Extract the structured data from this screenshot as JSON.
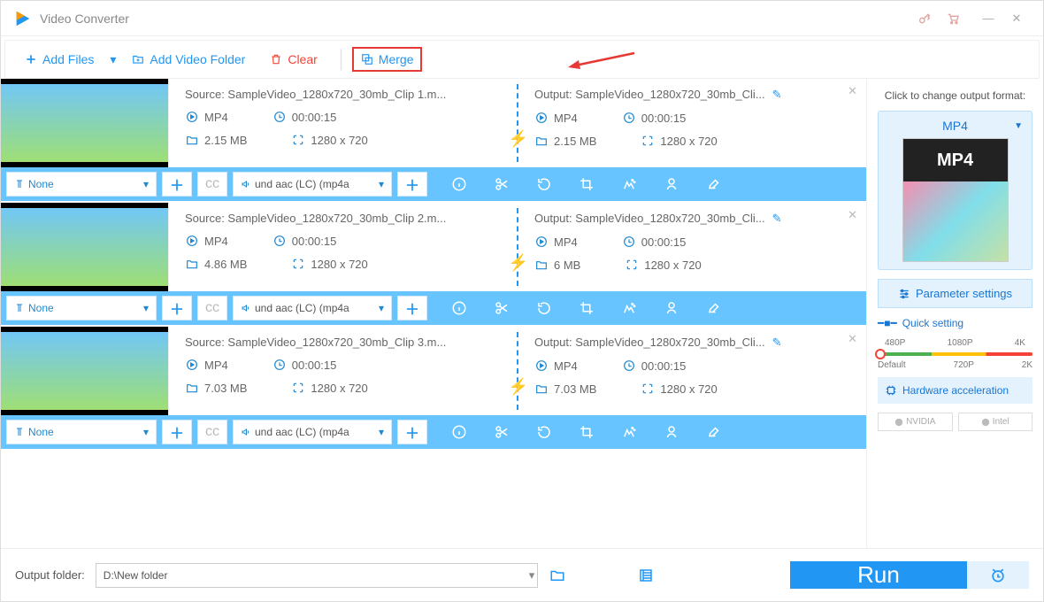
{
  "app": {
    "title": "Video Converter"
  },
  "toolbar": {
    "add_files": "Add Files",
    "add_folder": "Add Video Folder",
    "clear": "Clear",
    "merge": "Merge"
  },
  "clips": [
    {
      "source": "Source: SampleVideo_1280x720_30mb_Clip 1.m...",
      "output": "Output: SampleVideo_1280x720_30mb_Cli...",
      "src_fmt": "MP4",
      "src_dur": "00:00:15",
      "src_size": "2.15 MB",
      "src_res": "1280 x 720",
      "out_fmt": "MP4",
      "out_dur": "00:00:15",
      "out_size": "2.15 MB",
      "out_res": "1280 x 720",
      "subtitle": "None",
      "audio": "und aac (LC) (mp4a"
    },
    {
      "source": "Source: SampleVideo_1280x720_30mb_Clip 2.m...",
      "output": "Output: SampleVideo_1280x720_30mb_Cli...",
      "src_fmt": "MP4",
      "src_dur": "00:00:15",
      "src_size": "4.86 MB",
      "src_res": "1280 x 720",
      "out_fmt": "MP4",
      "out_dur": "00:00:15",
      "out_size": "6 MB",
      "out_res": "1280 x 720",
      "subtitle": "None",
      "audio": "und aac (LC) (mp4a"
    },
    {
      "source": "Source: SampleVideo_1280x720_30mb_Clip 3.m...",
      "output": "Output: SampleVideo_1280x720_30mb_Cli...",
      "src_fmt": "MP4",
      "src_dur": "00:00:15",
      "src_size": "7.03 MB",
      "src_res": "1280 x 720",
      "out_fmt": "MP4",
      "out_dur": "00:00:15",
      "out_size": "7.03 MB",
      "out_res": "1280 x 720",
      "subtitle": "None",
      "audio": "und aac (LC) (mp4a"
    }
  ],
  "bottom": {
    "output_folder_label": "Output folder:",
    "output_folder": "D:\\New folder",
    "run": "Run"
  },
  "sidebar": {
    "change_label": "Click to change output format:",
    "format": "MP4",
    "param": "Parameter settings",
    "quick": "Quick setting",
    "ticks_top": [
      "480P",
      "1080P",
      "4K"
    ],
    "ticks_bot": [
      "Default",
      "720P",
      "2K"
    ],
    "hw": "Hardware acceleration",
    "chips": [
      "NVIDIA",
      "Intel"
    ]
  }
}
